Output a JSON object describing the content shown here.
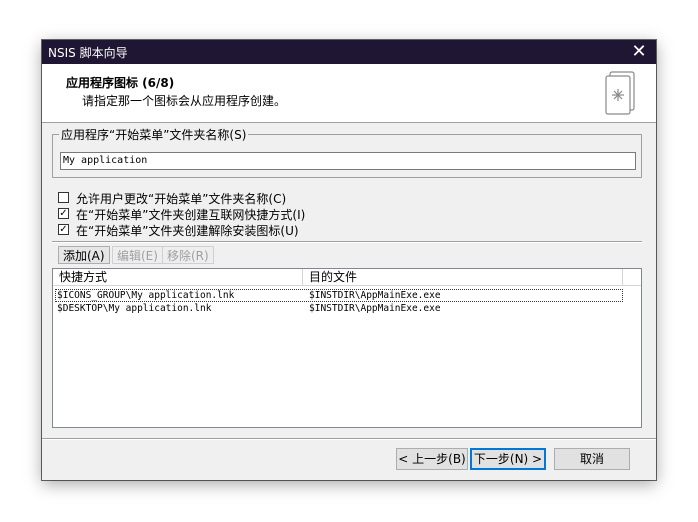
{
  "window": {
    "title": "NSIS 脚本向导",
    "close_glyph": "✕"
  },
  "header": {
    "title": "应用程序图标 (6/8)",
    "subtitle": "请指定那一个图标会从应用程序创建。"
  },
  "group": {
    "label": "应用程序“开始菜单”文件夹名称(S)",
    "value": "My application"
  },
  "checkboxes": [
    {
      "label": "允许用户更改“开始菜单”文件夹名称(C)",
      "checked": false
    },
    {
      "label": "在“开始菜单”文件夹创建互联网快捷方式(I)",
      "checked": true
    },
    {
      "label": "在“开始菜单”文件夹创建解除安装图标(U)",
      "checked": true
    }
  ],
  "toolbar": {
    "add": "添加(A)",
    "edit": "编辑(E)",
    "remove": "移除(R)"
  },
  "list": {
    "columns": [
      "快捷方式",
      "目的文件"
    ],
    "rows": [
      {
        "shortcut": "$ICONS_GROUP\\My application.lnk",
        "target": "$INSTDIR\\AppMainExe.exe"
      },
      {
        "shortcut": "$DESKTOP\\My application.lnk",
        "target": "$INSTDIR\\AppMainExe.exe"
      }
    ]
  },
  "buttons": {
    "back": "< 上一步(B)",
    "next": "下一步(N) >",
    "cancel": "取消"
  },
  "colors": {
    "titlebar": "#1e1633",
    "dialog_bg": "#f0f0f0",
    "accent": "#0078d7"
  }
}
